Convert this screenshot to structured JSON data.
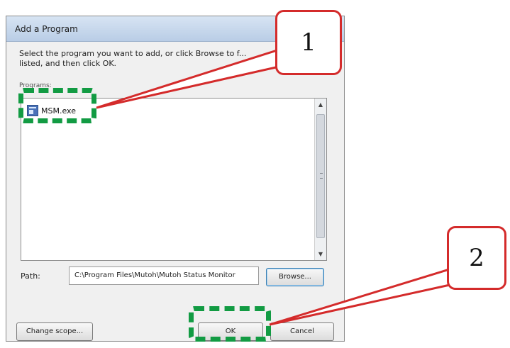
{
  "dialog": {
    "title": "Add a Program",
    "instruction": "Select the program you want to add, or click Browse to f... listed, and then click OK.",
    "programs_label": "Programs:",
    "programs": [
      {
        "label": "MSM.exe",
        "icon": "program-icon"
      }
    ],
    "path_label": "Path:",
    "path_value": "C:\\Program Files\\Mutoh\\Mutoh Status Monitor",
    "browse_label": "Browse...",
    "change_scope_label": "Change scope...",
    "ok_label": "OK",
    "cancel_label": "Cancel"
  },
  "annotations": {
    "callout_1": "1",
    "callout_2": "2",
    "highlight_color": "#129b43",
    "callout_border_color": "#d42b2b"
  }
}
